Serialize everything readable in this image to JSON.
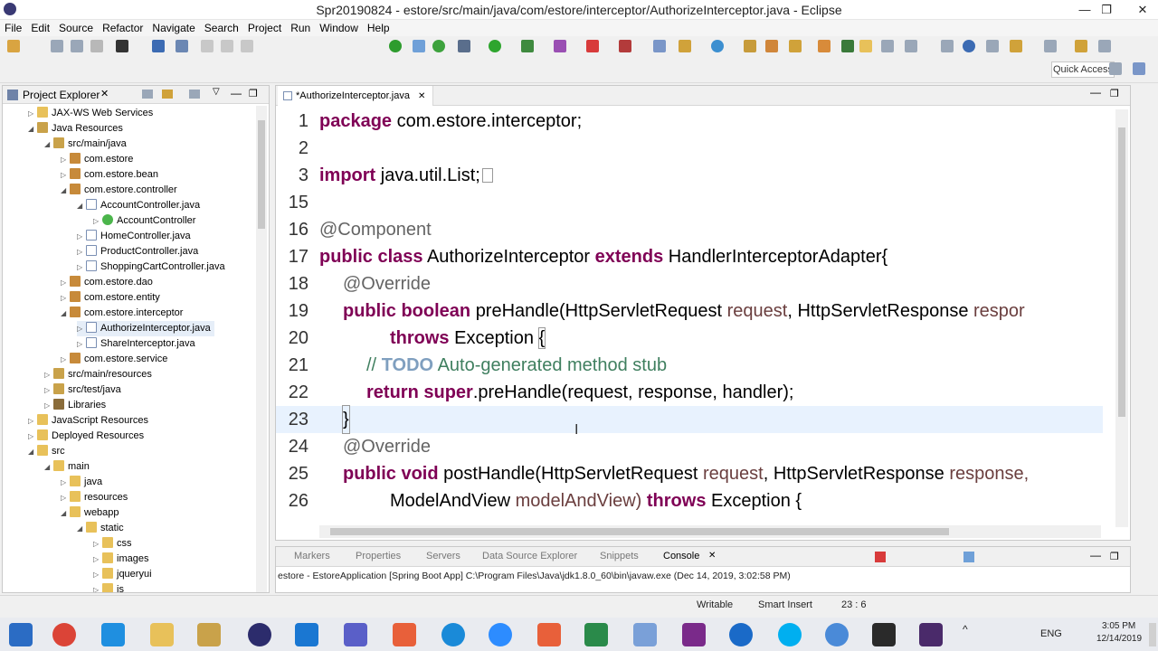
{
  "window": {
    "title": "Spr20190824 - estore/src/main/java/com/estore/interceptor/AuthorizeInterceptor.java - Eclipse",
    "minimize": "—",
    "maximize": "❐",
    "close": "✕"
  },
  "menu": [
    "File",
    "Edit",
    "Source",
    "Refactor",
    "Navigate",
    "Search",
    "Project",
    "Run",
    "Window",
    "Help"
  ],
  "quick_access": "Quick Access",
  "explorer": {
    "title": "Project Explorer",
    "items": [
      "JAX-WS Web Services",
      "Java Resources",
      "src/main/java",
      "com.estore",
      "com.estore.bean",
      "com.estore.controller",
      "AccountController.java",
      "AccountController",
      "HomeController.java",
      "ProductController.java",
      "ShoppingCartController.java",
      "com.estore.dao",
      "com.estore.entity",
      "com.estore.interceptor",
      "AuthorizeInterceptor.java",
      "ShareInterceptor.java",
      "com.estore.service",
      "src/main/resources",
      "src/test/java",
      "Libraries",
      "JavaScript Resources",
      "Deployed Resources",
      "src",
      "main",
      "java",
      "resources",
      "webapp",
      "static",
      "css",
      "images",
      "jqueryui",
      "js"
    ]
  },
  "editor": {
    "tab": "*AuthorizeInterceptor.java",
    "lines": {
      "n1": "1",
      "n2": "2",
      "n3": "3",
      "n15": "15",
      "n16": "16",
      "n17": "17",
      "n18": "18",
      "n19": "19",
      "n20": "20",
      "n21": "21",
      "n22": "22",
      "n23": "23",
      "n24": "24",
      "n25": "25",
      "n26": "26",
      "kw_package": "package",
      "pkg_name": " com.estore.interceptor;",
      "kw_import": "import",
      "import_name": " java.util.List;",
      "ann_component": "@Component",
      "kw_public": "public",
      "kw_class": "class",
      "class_name": "AuthorizeInterceptor",
      "kw_extends": "extends",
      "super_name": "HandlerInterceptorAdapter{",
      "ann_override": "@Override",
      "kw_boolean": "boolean",
      "m_prehandle": "preHandle(HttpServletRequest",
      "v_request": "request",
      "t_response": "HttpServletResponse",
      "v_response_cut": "respor",
      "kw_throws": "throws",
      "exc": "Exception",
      "brace_open": "{",
      "c_slashes": "//",
      "c_todo": "TODO",
      "c_text": "Auto-generated method stub",
      "kw_return": "return",
      "kw_super": "super",
      "super_call": ".preHandle(request, response, handler);",
      "brace_close": "}",
      "kw_void": "void",
      "m_posthandle": "postHandle(HttpServletRequest",
      "v_response": "response,",
      "mav": "ModelAndView",
      "v_mav": "modelAndView)",
      "exc_brace": "Exception {",
      "comma": ","
    }
  },
  "console": {
    "tabs": [
      "Markers",
      "Properties",
      "Servers",
      "Data Source Explorer",
      "Snippets",
      "Console"
    ],
    "line": "estore - EstoreApplication [Spring Boot App] C:\\Program Files\\Java\\jdk1.8.0_60\\bin\\javaw.exe (Dec 14, 2019, 3:02:58 PM)"
  },
  "status": {
    "writable": "Writable",
    "insert": "Smart Insert",
    "position": "23 : 6"
  },
  "taskbar": {
    "lang": "ENG",
    "time": "3:05 PM",
    "date": "12/14/2019"
  }
}
